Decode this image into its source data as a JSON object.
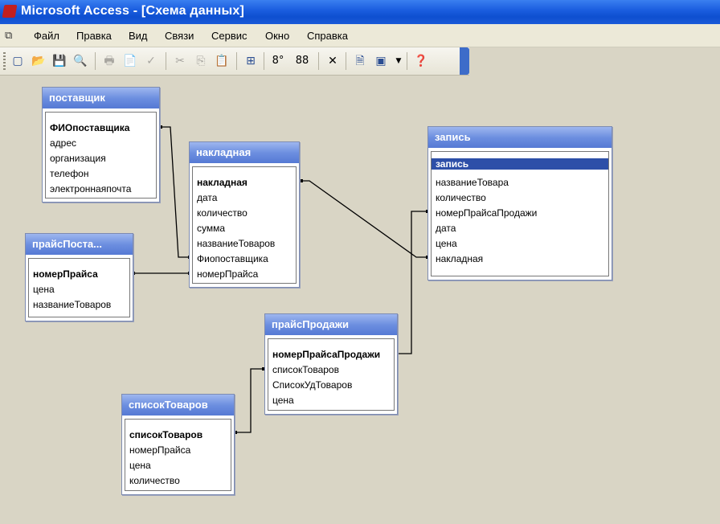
{
  "window": {
    "title": "Microsoft Access - [Схема данных]"
  },
  "menu": [
    "Файл",
    "Правка",
    "Вид",
    "Связи",
    "Сервис",
    "Окно",
    "Справка"
  ],
  "toolbar": {
    "icons": [
      "new-icon",
      "open-icon",
      "save-icon",
      "search-icon",
      "print-icon",
      "preview-icon",
      "spell-icon",
      "cut-icon",
      "copy-icon",
      "paste-icon",
      "show-table-icon",
      "show-direct-icon",
      "show-all-icon",
      "delete-icon",
      "properties-icon",
      "object-icon",
      "help-icon"
    ],
    "glyphs": [
      "▢",
      "📂",
      "💾",
      "🔍",
      "🖶",
      "📄",
      "✓",
      "✂",
      "⎘",
      "📋",
      "⊞",
      "8°",
      "88",
      "✕",
      "🗎",
      "▣",
      "❓"
    ]
  },
  "tables": {
    "postavshchik": {
      "title": "поставщик",
      "fields": [
        "ФИОпоставщика",
        "адрес",
        "организация",
        "телефон",
        "электроннаяпочта"
      ]
    },
    "nakladnaya": {
      "title": "накладная",
      "fields": [
        "накладная",
        "дата",
        "количество",
        "сумма",
        "названиеТоваров",
        "Фиопоставщика",
        "номерПрайса"
      ]
    },
    "zapis": {
      "title": "запись",
      "fields": [
        "запись",
        "названиеТовара",
        "количество",
        "номерПрайсаПродажи",
        "дата",
        "цена",
        "накладная"
      ]
    },
    "praisPost": {
      "title": "прайсПоста...",
      "fields": [
        "номерПрайса",
        "цена",
        "названиеТоваров"
      ]
    },
    "praisProdazhi": {
      "title": "прайсПродажи",
      "fields": [
        "номерПрайсаПродажи",
        "списокТоваров",
        "СписокУдТоваров",
        "цена"
      ]
    },
    "spisokTovarov": {
      "title": "списокТоваров",
      "fields": [
        "списокТоваров",
        "номерПрайса",
        "цена",
        "количество"
      ]
    }
  }
}
